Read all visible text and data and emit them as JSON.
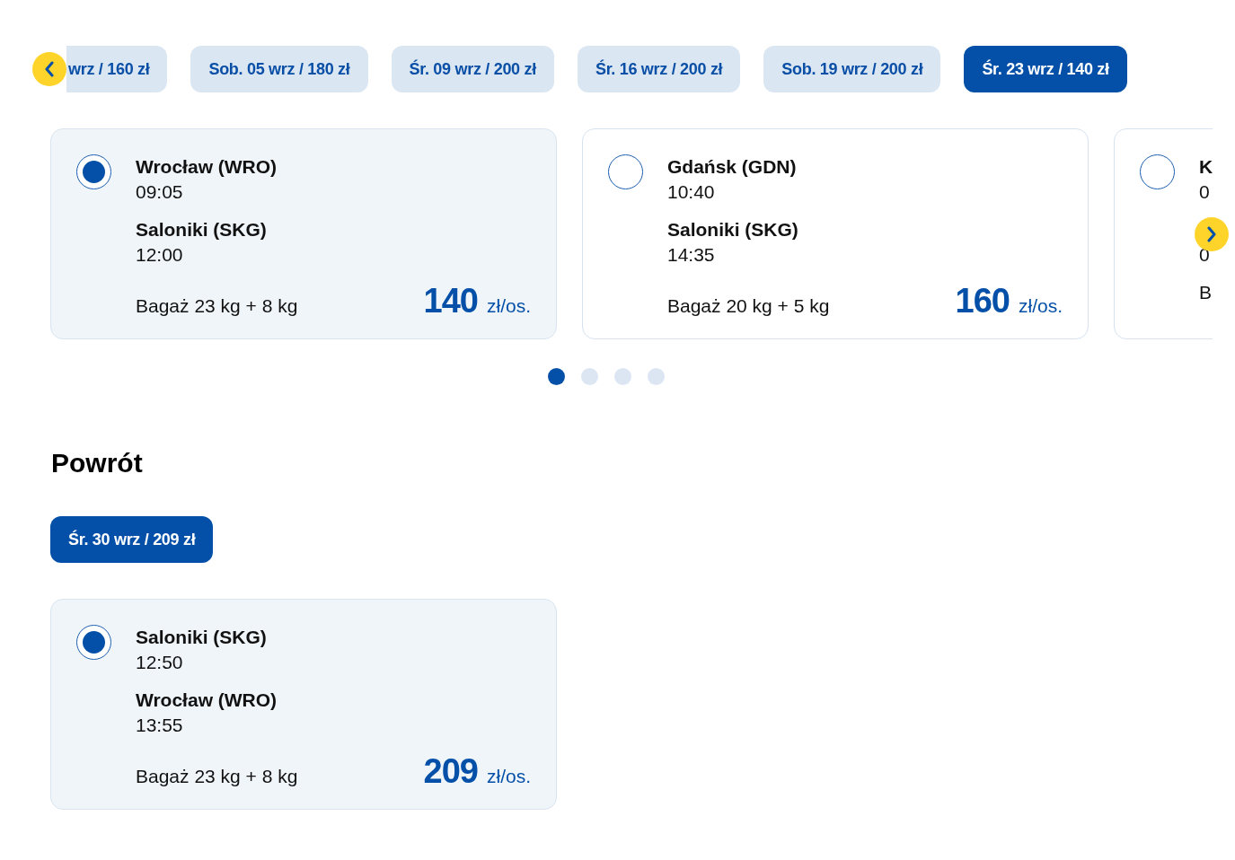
{
  "outbound": {
    "dates": [
      {
        "label": "wrz / 160 zł",
        "selected": false
      },
      {
        "label": "Sob. 05 wrz / 180 zł",
        "selected": false
      },
      {
        "label": "Śr. 09 wrz / 200 zł",
        "selected": false
      },
      {
        "label": "Śr. 16 wrz / 200 zł",
        "selected": false
      },
      {
        "label": "Sob. 19 wrz / 200 zł",
        "selected": false
      },
      {
        "label": "Śr. 23 wrz / 140 zł",
        "selected": true
      }
    ],
    "flights": [
      {
        "selected": true,
        "from_airport": "Wrocław (WRO)",
        "from_time": "09:05",
        "to_airport": "Saloniki (SKG)",
        "to_time": "12:00",
        "baggage": "Bagaż 23 kg + 8 kg",
        "price": "140",
        "price_unit": "zł/os."
      },
      {
        "selected": false,
        "from_airport": "Gdańsk (GDN)",
        "from_time": "10:40",
        "to_airport": "Saloniki (SKG)",
        "to_time": "14:35",
        "baggage": "Bagaż 20 kg + 5 kg",
        "price": "160",
        "price_unit": "zł/os."
      },
      {
        "selected": false,
        "from_airport": "K",
        "from_time": "0",
        "to_time": "0",
        "baggage": "B"
      }
    ],
    "pager": [
      {
        "selected": true
      },
      {
        "selected": false
      },
      {
        "selected": false
      },
      {
        "selected": false
      }
    ]
  },
  "return": {
    "heading": "Powrót",
    "dates": [
      {
        "label": "Śr. 30 wrz / 209 zł",
        "selected": true
      }
    ],
    "flights": [
      {
        "selected": true,
        "from_airport": "Saloniki (SKG)",
        "from_time": "12:50",
        "to_airport": "Wrocław (WRO)",
        "to_time": "13:55",
        "baggage": "Bagaż 23 kg + 8 kg",
        "price": "209",
        "price_unit": "zł/os."
      }
    ]
  }
}
